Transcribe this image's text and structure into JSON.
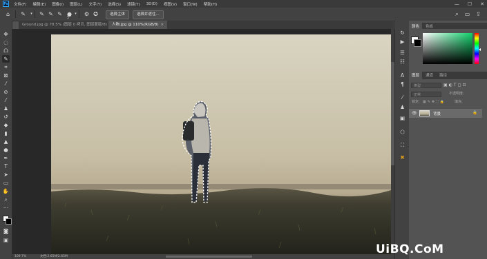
{
  "menubar": {
    "items": [
      "文件(F)",
      "编辑(E)",
      "图像(I)",
      "图层(L)",
      "文字(Y)",
      "选择(S)",
      "滤镜(T)",
      "3D(D)",
      "视图(V)",
      "窗口(W)",
      "帮助(H)"
    ],
    "window_controls": [
      "—",
      "☐",
      "✕"
    ]
  },
  "options": {
    "select_subject_label": "选择主体",
    "select_and_mask_label": "选择并遮住...",
    "brush_size": "5"
  },
  "tabs": [
    {
      "label": "Ground.jpg @ 78.5% (图层 0 拷贝, 图层蒙版/8) *",
      "active": false
    },
    {
      "label": "人物.jpg @ 110%(RGB/8)",
      "active": true
    }
  ],
  "status": {
    "zoom": "109.7%",
    "doc": "文档:2.65M/2.65M"
  },
  "color_panel": {
    "tabs": [
      "颜色",
      "色板"
    ],
    "foreground": "#ffffff",
    "background": "#000000"
  },
  "layers_panel": {
    "tabs": [
      "图层",
      "通道",
      "路径"
    ],
    "kind_filter": "类型",
    "blend_mode": "正常",
    "opacity_label": "不透明度:",
    "lock_label": "锁定:",
    "fill_label": "填充:",
    "layer": {
      "name": "背景",
      "visible": true,
      "locked": true
    }
  },
  "watermark": "UiBQ.CoM"
}
